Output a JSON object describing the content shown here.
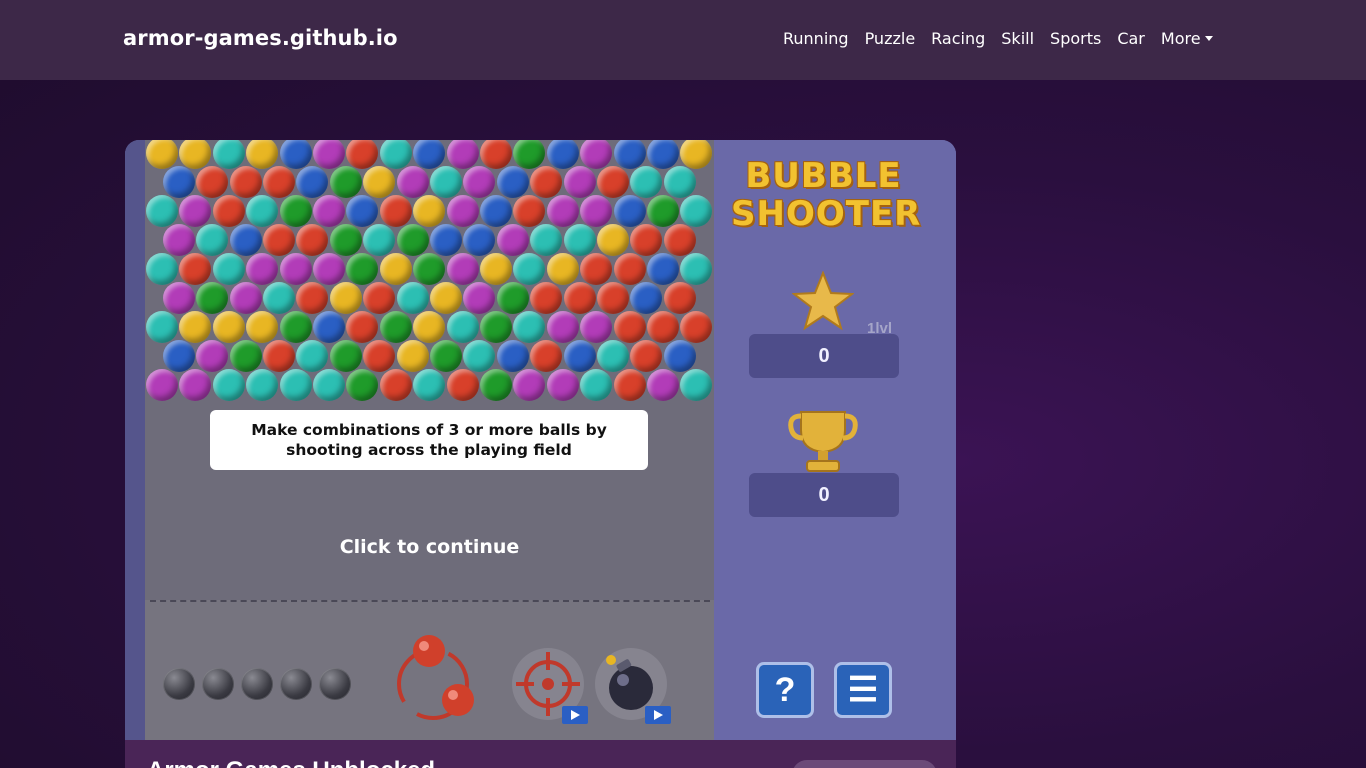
{
  "site": {
    "brand": "armor-games.github.io",
    "nav": [
      "Running",
      "Puzzle",
      "Racing",
      "Skill",
      "Sports",
      "Car",
      "More"
    ]
  },
  "game": {
    "logo_line1": "BUBBLE",
    "logo_line2": "SHOOTER",
    "level": "1lvl",
    "score": "0",
    "best": "0",
    "instruction": "Make combinations of 3 or more balls by shooting across the playing field",
    "continue_text": "Click to continue",
    "help_icon": "?",
    "menu_icon": "☰",
    "bubble_colors": {
      "Y": "#e8b623",
      "T": "#2cbfb3",
      "B": "#2a5fc4",
      "P": "#b23cb8",
      "R": "#d8402a",
      "G": "#1f9b2a"
    },
    "grid": [
      "YYTYBPRTBPRGBPBBY",
      "BRRRBGYPTPBRPRTT",
      "TPRTGPBRYPBRPPBGT",
      "PTBRRGTGBBPTTYRR",
      "TRTPPPGYGPYTYRRBT",
      "PGPTRYRTYPGRRRBR",
      "TYYYGBRGYTGTPPRRR",
      "BPGRTGRYGTBRBTRB",
      "PPTTTTGRTRGPPTRPT"
    ]
  },
  "page": {
    "section_title": "Armor Games Unblocked"
  }
}
